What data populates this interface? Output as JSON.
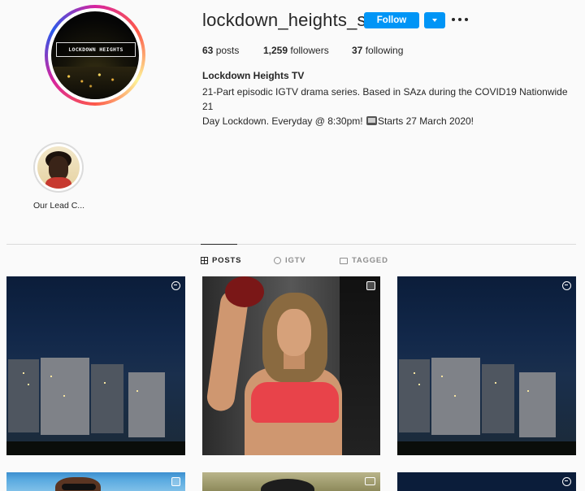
{
  "profile": {
    "username": "lockdown_heights_sa",
    "follow_label": "Follow",
    "avatar_banner_text": "LOCKDOWN HEIGHTS",
    "stats": {
      "posts_count": "63",
      "posts_label": "posts",
      "followers_count": "1,259",
      "followers_label": "followers",
      "following_count": "37",
      "following_label": "following"
    },
    "full_name": "Lockdown Heights TV",
    "bio_line1": "21-Part episodic IGTV drama series. Based in SAᴢᴀ during the COVID19 Nationwide 21",
    "bio_line2_before_icon": "Day Lockdown. Everyday @ 8:30pm! ",
    "bio_line2_after_icon": "Starts 27 March 2020!"
  },
  "highlights": [
    {
      "label": "Our Lead C..."
    }
  ],
  "tabs": {
    "posts": "POSTS",
    "igtv": "IGTV",
    "tagged": "TAGGED"
  },
  "posts": [
    {
      "kind": "city-night",
      "badge_icon": "reel-icon"
    },
    {
      "kind": "fitness",
      "badge_icon": "multi-photo-icon"
    },
    {
      "kind": "city-night",
      "badge_icon": "reel-icon"
    },
    {
      "kind": "beach-selfie",
      "badge_icon": "multi-photo-icon"
    },
    {
      "kind": "garden",
      "badge_icon": "video-icon"
    },
    {
      "kind": "night",
      "badge_icon": "reel-icon"
    }
  ],
  "colors": {
    "accent": "#0095f6",
    "background": "#fafafa",
    "text": "#262626",
    "muted": "#8e8e8e",
    "divider": "#dbdbdb"
  }
}
